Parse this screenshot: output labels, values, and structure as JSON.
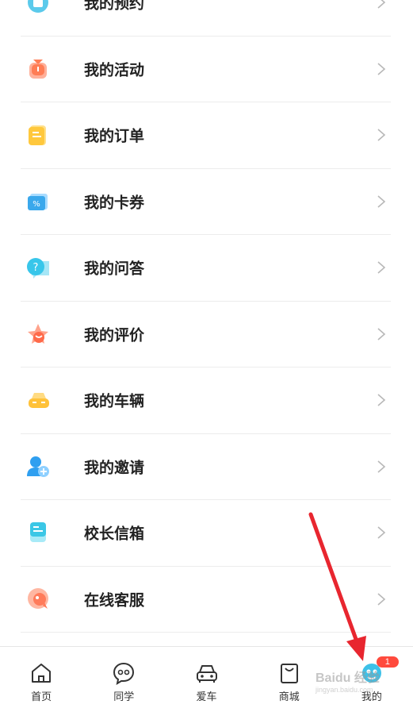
{
  "menu": {
    "items": [
      {
        "label": "我的预约",
        "icon": "calendar-icon",
        "color": "#3ec1e8"
      },
      {
        "label": "我的活动",
        "icon": "activity-icon",
        "color": "#ff7d55"
      },
      {
        "label": "我的订单",
        "icon": "order-icon",
        "color": "#ffc83d"
      },
      {
        "label": "我的卡券",
        "icon": "coupon-icon",
        "color": "#3aa8ec"
      },
      {
        "label": "我的问答",
        "icon": "qa-icon",
        "color": "#38c6ea"
      },
      {
        "label": "我的评价",
        "icon": "review-icon",
        "color": "#ff6a4a"
      },
      {
        "label": "我的车辆",
        "icon": "car-icon",
        "color": "#ffc23a"
      },
      {
        "label": "我的邀请",
        "icon": "invite-icon",
        "color": "#2f9ff0"
      },
      {
        "label": "校长信箱",
        "icon": "mailbox-icon",
        "color": "#3bc7e6"
      },
      {
        "label": "在线客服",
        "icon": "service-icon",
        "color": "#ff7b5a"
      }
    ]
  },
  "tabbar": {
    "tabs": [
      {
        "label": "首页",
        "icon": "home-icon"
      },
      {
        "label": "同学",
        "icon": "chat-icon"
      },
      {
        "label": "爱车",
        "icon": "car-outline-icon"
      },
      {
        "label": "商城",
        "icon": "shop-bag-icon"
      },
      {
        "label": "我的",
        "icon": "profile-icon",
        "active": true,
        "badge": "1"
      }
    ]
  },
  "watermark": {
    "text": "Baidu 经验",
    "sub": "jingyan.baidu.com"
  },
  "colors": {
    "accent": "#3ec1e8",
    "badge": "#ff4a3d",
    "annotation_arrow": "#e8262f"
  }
}
